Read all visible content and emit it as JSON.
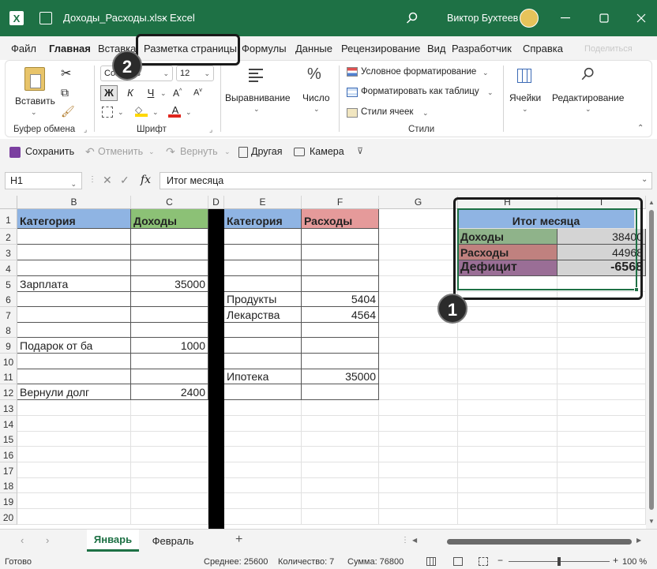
{
  "window": {
    "filename": "Доходы_Расходы.xlsx",
    "app": "Excel",
    "user": "Виктор Бухтеев"
  },
  "ribbon_tabs": [
    "Файл",
    "Главная",
    "Вставка",
    "Разметка страницы",
    "Формулы",
    "Данные",
    "Рецензирование",
    "Вид",
    "Разработчик",
    "Справка"
  ],
  "share_label": "Поделиться",
  "ribbon": {
    "paste_label": "Вставить",
    "clipboard_group": "Буфер обмена",
    "font_name": "Consolas",
    "font_size": "12",
    "bold_label": "Ж",
    "italic_label": "К",
    "underline_label": "Ч",
    "font_group": "Шрифт",
    "alignment_label": "Выравнивание",
    "number_label": "Число",
    "cond_format": "Условное форматирование",
    "format_table": "Форматировать как таблицу",
    "cell_styles": "Стили ячеек",
    "styles_group": "Стили",
    "cells_label": "Ячейки",
    "editing_label": "Редактирование"
  },
  "qat": {
    "save": "Сохранить",
    "undo": "Отменить",
    "redo": "Вернуть",
    "other": "Другая",
    "camera": "Камера"
  },
  "formula_bar": {
    "name_box": "H1",
    "fx": "fx",
    "formula": "Итог месяца"
  },
  "columns": [
    "B",
    "C",
    "D",
    "E",
    "F",
    "G",
    "H",
    "I"
  ],
  "rows": [
    "1",
    "2",
    "3",
    "4",
    "5",
    "6",
    "7",
    "8",
    "9",
    "10",
    "11",
    "12",
    "13",
    "14",
    "15",
    "16",
    "17",
    "18",
    "19",
    "20"
  ],
  "cells": {
    "B1": "Категория",
    "C1": "Доходы",
    "E1": "Категория",
    "F1": "Расходы",
    "B5": "Зарплата",
    "C5": "35000",
    "E6": "Продукты",
    "F6": "5404",
    "E7": "Лекарства",
    "F7": "4564",
    "B9": "Подарок от ба",
    "C9": "1000",
    "E11": "Ипотека",
    "F11": "35000",
    "B12": "Вернули долг",
    "C12": "2400",
    "H1": "Итог месяца",
    "H2": "Доходы",
    "I2": "38400",
    "H3": "Расходы",
    "I3": "44968",
    "H4": "Дефицит",
    "I4": "-6568"
  },
  "sheet_tabs": [
    "Январь",
    "Февраль"
  ],
  "status": {
    "ready": "Готово",
    "average": "Среднее: 25600",
    "count": "Количество: 7",
    "sum": "Сумма: 76800",
    "zoom": "100 %"
  },
  "callouts": [
    "1",
    "2"
  ],
  "colors": {
    "excel_green": "#1e7145",
    "header_blue": "#8fb4e3",
    "header_green": "#8cc176",
    "header_red": "#e59a9a",
    "summary_green": "#8fb38a",
    "summary_red": "#c0817f",
    "summary_purple": "#9a6e96",
    "summary_gray": "#d4d4d4"
  }
}
